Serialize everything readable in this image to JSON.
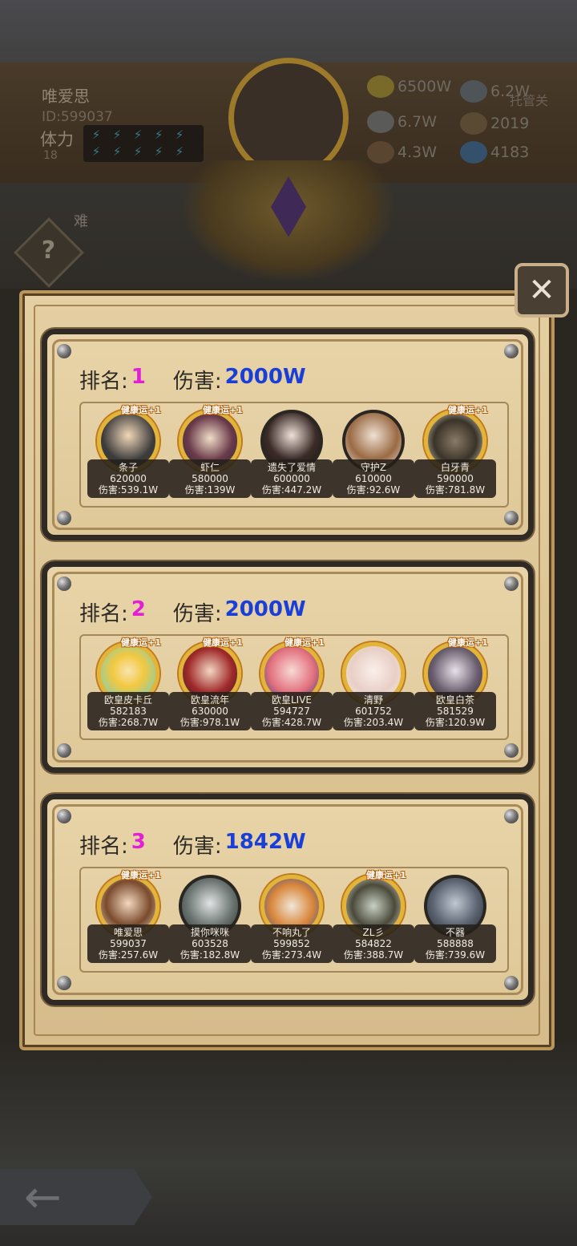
{
  "player": {
    "name": "唯爱思",
    "id": "ID:599037",
    "stamina_label": "体力",
    "stamina_value": "18"
  },
  "resources": {
    "gold": "6500W",
    "stone": "6.7W",
    "wood": "4.3W",
    "iron": "6.2W",
    "scroll": "2019",
    "crystal": "4183",
    "auto_label": "托管关"
  },
  "menu_tab_text": "难",
  "close_icon": "✕",
  "help_icon": "?",
  "back_icon": "←",
  "buff_label": "健康运+1",
  "labels": {
    "rank": "排名:",
    "damage": "伤害:"
  },
  "teams": [
    {
      "rank": "1",
      "damage": "2000W",
      "members": [
        {
          "name": "条子",
          "score": "620000",
          "damage": "伤害:539.1W",
          "buff": true
        },
        {
          "name": "虾仁",
          "score": "580000",
          "damage": "伤害:139W",
          "buff": true
        },
        {
          "name": "遗失了爱情",
          "score": "600000",
          "damage": "伤害:447.2W",
          "buff": false
        },
        {
          "name": "守护Z",
          "score": "610000",
          "damage": "伤害:92.6W",
          "buff": false
        },
        {
          "name": "白牙青",
          "score": "590000",
          "damage": "伤害:781.8W",
          "buff": true
        }
      ]
    },
    {
      "rank": "2",
      "damage": "2000W",
      "members": [
        {
          "name": "欧皇皮卡丘",
          "score": "582183",
          "damage": "伤害:268.7W",
          "buff": true
        },
        {
          "name": "欧皇流年",
          "score": "630000",
          "damage": "伤害:978.1W",
          "buff": true
        },
        {
          "name": "欧皇LIVE",
          "score": "594727",
          "damage": "伤害:428.7W",
          "buff": true
        },
        {
          "name": "清野",
          "score": "601752",
          "damage": "伤害:203.4W",
          "buff": false
        },
        {
          "name": "欧皇白茶",
          "score": "581529",
          "damage": "伤害:120.9W",
          "buff": true
        }
      ]
    },
    {
      "rank": "3",
      "damage": "1842W",
      "members": [
        {
          "name": "唯爱思",
          "score": "599037",
          "damage": "伤害:257.6W",
          "buff": true
        },
        {
          "name": "摸你咪咪",
          "score": "603528",
          "damage": "伤害:182.8W",
          "buff": false
        },
        {
          "name": "不响丸了",
          "score": "599852",
          "damage": "伤害:273.4W",
          "buff": false
        },
        {
          "name": "ZL彡",
          "score": "584822",
          "damage": "伤害:388.7W",
          "buff": true
        },
        {
          "name": "不器",
          "score": "588888",
          "damage": "伤害:739.6W",
          "buff": false
        }
      ]
    }
  ]
}
